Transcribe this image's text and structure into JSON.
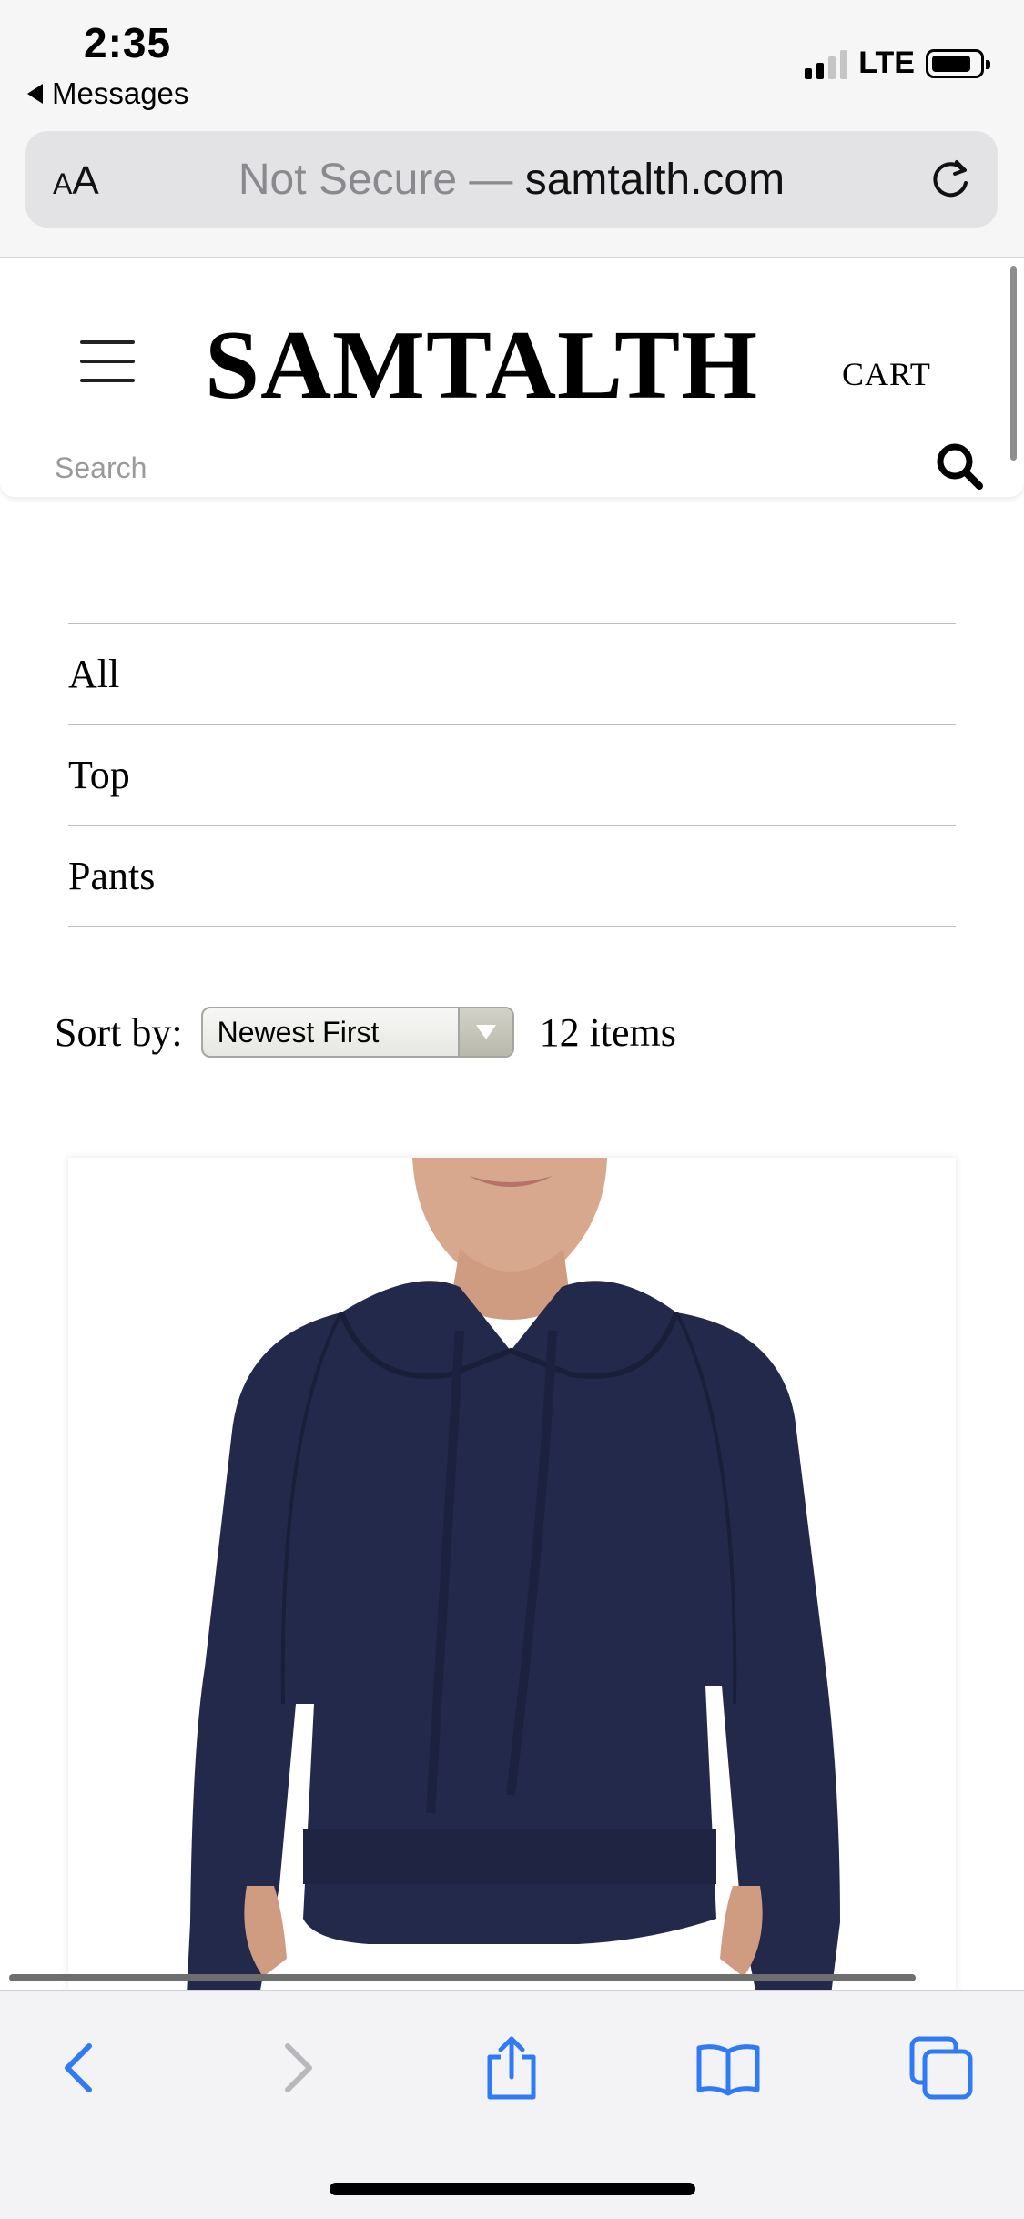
{
  "status_bar": {
    "time": "2:35",
    "back_label": "Messages",
    "network": "LTE"
  },
  "browser": {
    "text_size_label": "AA",
    "url_not_secure": "Not Secure —",
    "url_domain": "samtalth.com",
    "icons": {
      "reload": "reload-icon",
      "back": "back-arrow-icon",
      "forward": "forward-arrow-icon",
      "share": "share-icon",
      "bookmarks": "bookmarks-icon",
      "tabs": "tabs-icon"
    },
    "accent_color": "#2f7bf6"
  },
  "site": {
    "logo": "SAMTALTH",
    "cart_label": "CART",
    "search_placeholder": "Search"
  },
  "categories": [
    "All",
    "Top",
    "Pants"
  ],
  "sort": {
    "label": "Sort by:",
    "selected": "Newest First",
    "item_count": "12 items"
  },
  "product": {
    "image_desc_color": "#23294a"
  }
}
